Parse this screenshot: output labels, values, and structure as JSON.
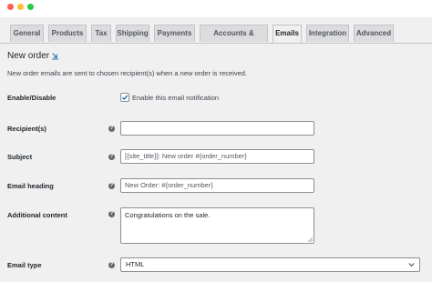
{
  "tabs": [
    "General",
    "Products",
    "Tax",
    "Shipping",
    "Payments",
    "Accounts & Privacy",
    "Emails",
    "Integration",
    "Advanced"
  ],
  "active_tab": "Emails",
  "page": {
    "title": "New order",
    "description": "New order emails are sent to chosen recipient(s) when a new order is received."
  },
  "fields": {
    "enable": {
      "label": "Enable/Disable",
      "checkbox_label": "Enable this email notification",
      "checked": true
    },
    "recipients": {
      "label": "Recipient(s)",
      "value": ""
    },
    "subject": {
      "label": "Subject",
      "placeholder": "[{site_title}]: New order #{order_number}"
    },
    "heading": {
      "label": "Email heading",
      "placeholder": "New Order: #{order_number}"
    },
    "additional": {
      "label": "Additional content",
      "value": "Congratulations on the sale."
    },
    "email_type": {
      "label": "Email type",
      "value": "HTML"
    }
  },
  "colors": {
    "accent": "#2271b1",
    "background": "#f0f0f1",
    "tab_inactive": "#dcdcde"
  }
}
